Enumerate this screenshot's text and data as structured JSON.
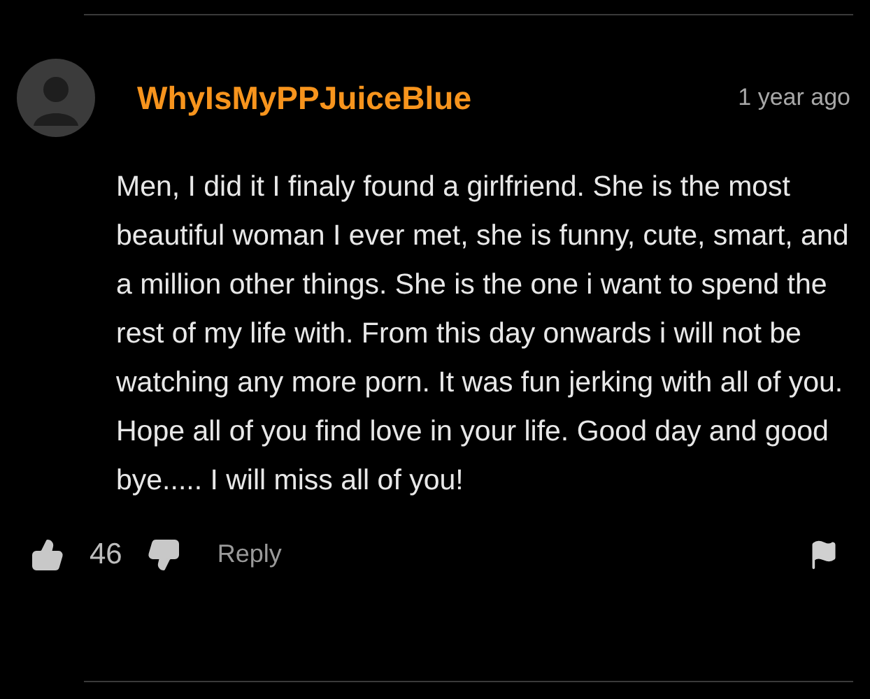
{
  "comment": {
    "username": "WhyIsMyPPJuiceBlue",
    "time": "1 year ago",
    "text": "Men, I did it I finaly found a girlfriend. She is the most beautiful woman I ever met, she is funny, cute, smart, and a million other things. She is the one i want to spend the rest of my life with. From this day onwards i will not be watching any more porn. It was fun jerking with all of you. Hope all of you find love in your life. Good day and good bye..... I will miss all of you!",
    "likes": "46",
    "reply": "Reply"
  }
}
